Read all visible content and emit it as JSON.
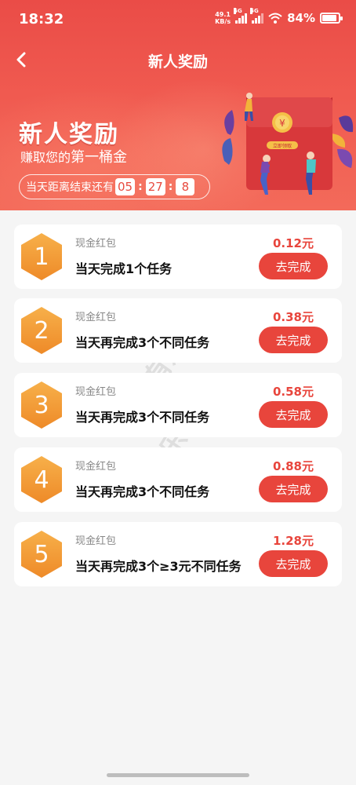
{
  "status_bar": {
    "time": "18:32",
    "net_speed_value": "49.1",
    "net_speed_unit": "KB/s",
    "sim1_tag": "5G",
    "sim2_tag": "5G",
    "battery_pct": "84%"
  },
  "nav": {
    "title": "新人奖励",
    "back_icon": "chevron-left-icon"
  },
  "hero": {
    "title": "新人奖励",
    "subtitle_lead": "赚取您的",
    "subtitle_main": "第一桶金",
    "countdown_label": "当天距离结束还有",
    "countdown_hours": "05",
    "countdown_minutes": "27",
    "countdown_seconds": "8",
    "envelope_label": "立即领取",
    "envelope_coin": "¥"
  },
  "tasks": [
    {
      "num": "1",
      "type": "现金红包",
      "task": "当天完成1个任务",
      "amount": "0.12元",
      "button": "去完成"
    },
    {
      "num": "2",
      "type": "现金红包",
      "task": "当天再完成3个不同任务",
      "amount": "0.38元",
      "button": "去完成"
    },
    {
      "num": "3",
      "type": "现金红包",
      "task": "当天再完成3个不同任务",
      "amount": "0.58元",
      "button": "去完成"
    },
    {
      "num": "4",
      "type": "现金红包",
      "task": "当天再完成3个不同任务",
      "amount": "0.88元",
      "button": "去完成"
    },
    {
      "num": "5",
      "type": "现金红包",
      "task": "当天再完成3个≥3元不同任务",
      "amount": "1.28元",
      "button": "去完成"
    }
  ],
  "watermark": "有乐帮",
  "colors": {
    "brand_red": "#e8453c",
    "header_red": "#ea4c47",
    "hex_orange": "#f29a2e",
    "page_bg": "#f5f5f5"
  }
}
